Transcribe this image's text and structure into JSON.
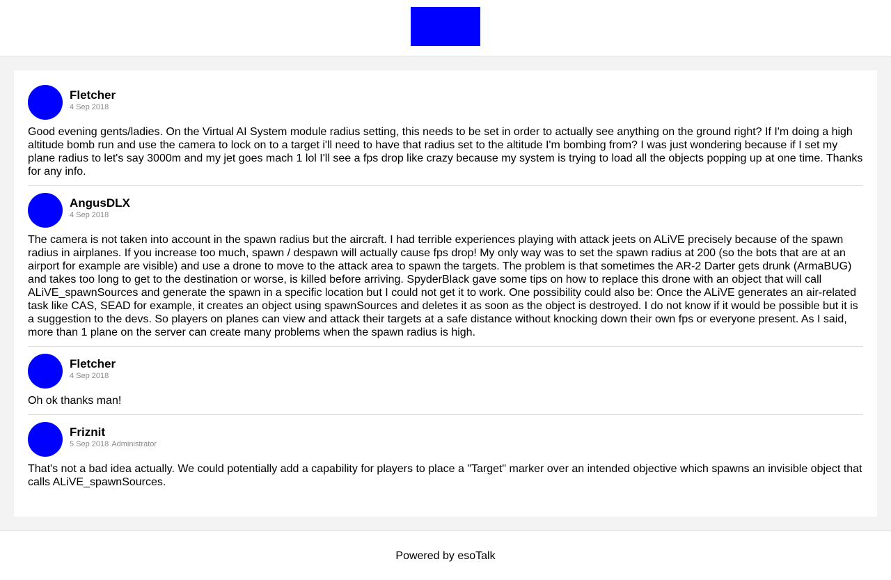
{
  "header": {
    "logo": "logo"
  },
  "posts": [
    {
      "author": "Fletcher",
      "date": "4 Sep 2018",
      "role": "",
      "body": "Good evening gents/ladies. On the Virtual AI System module radius setting, this needs to be set in order to actually see anything on the ground right? If I'm doing a high altitude bomb run and use the camera to lock on to a target i'll need to have that radius set to the altitude I'm bombing from? I was just wondering because if I set my plane radius to let's say 3000m and my jet goes mach 1 lol I'll see a fps drop like crazy because my system is trying to load all the objects popping up at one time. Thanks for any info."
    },
    {
      "author": "AngusDLX",
      "date": "4 Sep 2018",
      "role": "",
      "body": "The camera is not taken into account in the spawn radius but the aircraft. I had terrible experiences playing with attack jeets on ALiVE precisely because of the spawn radius in airplanes. If you increase too much, spawn / despawn will actually cause fps drop! My only way was to set the spawn radius at 200 (so the bots that are at an airport for example are visible) and use a drone to move to the attack area to spawn the targets. The problem is that sometimes the AR-2 Darter gets drunk (ArmaBUG) and takes too long to get to the destination or worse, is killed before arriving. SpyderBlack gave some tips on how to replace this drone with an object that will call ALiVE_spawnSources and generate the spawn in a specific location but I could not get it to work. One possibility could also be: Once the ALiVE generates an air-related task like CAS, SEAD for example, it creates an object using spawnSources and deletes it as soon as the object is destroyed. I do not know if it would be possible but it is a suggestion to the devs. So players on planes can view and attack their targets at a safe distance without knocking down their own fps or everyone present. As I said, more than 1 plane on the server can create many problems when the spawn radius is high."
    },
    {
      "author": "Fletcher",
      "date": "4 Sep 2018",
      "role": "",
      "body": "Oh ok thanks man!"
    },
    {
      "author": "Friznit",
      "date": "5 Sep 2018",
      "role": "Administrator",
      "body": "That's not a bad idea actually. We could potentially add a capability for players to place a \"Target\" marker over an intended objective which spawns an invisible object that calls ALiVE_spawnSources."
    }
  ],
  "footer": {
    "text": "Powered by esoTalk"
  },
  "colors": {
    "accent": "#0000ff",
    "background": "#f3f3f3"
  }
}
